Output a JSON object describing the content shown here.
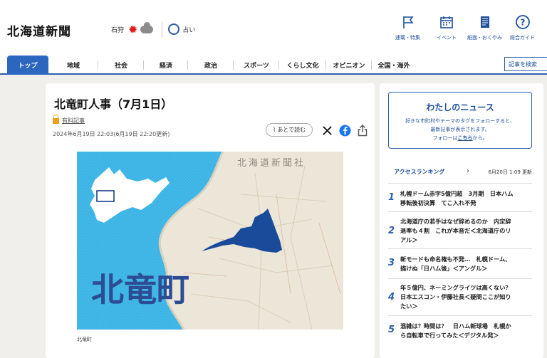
{
  "header": {
    "logo": "北海道新聞",
    "weather_location": "石狩",
    "fortune_label": "占い",
    "nav": [
      {
        "label": "連載・特集",
        "icon": "flag-icon"
      },
      {
        "label": "イベント",
        "icon": "calendar-icon"
      },
      {
        "label": "紙面・おくやみ",
        "icon": "newspaper-icon"
      },
      {
        "label": "総合ガイド",
        "icon": "help-icon"
      }
    ]
  },
  "tabs": [
    "トップ",
    "地域",
    "社会",
    "経済",
    "政治",
    "スポーツ",
    "くらし文化",
    "オピニオン",
    "全国・海外"
  ],
  "search_label": "記事を検索",
  "article": {
    "title": "北竜町人事（7月1日）",
    "badge": "有料記事",
    "date": "2024年6月19日 22:03(6月19日 22:20更新)",
    "read_later": "あとで読む",
    "image_watermark": "北海道新聞社",
    "image_text": "北竜町",
    "caption": "北竜町"
  },
  "sidebar": {
    "mynews": {
      "title": "わたしのニュース",
      "line1": "好きな市町村やテーマのタグをフォローすると、",
      "line2": "最新記事が表示されます。",
      "line3_pre": "フォローは",
      "line3_link": "こちら",
      "line3_post": "から。"
    },
    "ranking": {
      "title": "アクセスランキング",
      "updated": "6月20日 1:09 更新",
      "items": [
        {
          "rank": "1",
          "lines": [
            "札幌ドーム赤字5億円超　3月期　日本ハム",
            "移転後初決算　てこ入れ不発"
          ]
        },
        {
          "rank": "2",
          "lines": [
            "北海道庁の若手はなぜ辞めるのか　内定辞",
            "退率も４割　これが本音だ＜北海道庁のリ",
            "アル＞"
          ]
        },
        {
          "rank": "3",
          "lines": [
            "新モードも命名権も不発…　札幌ドーム、",
            "描けぬ「日ハム後」＜アングル＞"
          ]
        },
        {
          "rank": "4",
          "lines": [
            "年５億円、ネーミングライツは高くない？",
            "日本エスコン・伊藤社長＜疑問ここが知り",
            "たい＞"
          ]
        },
        {
          "rank": "5",
          "lines": [
            "混雑は？時間は？　日ハム新球場　札幌か",
            "ら自転車で行ってみた＜デジタル発＞"
          ]
        }
      ]
    }
  }
}
